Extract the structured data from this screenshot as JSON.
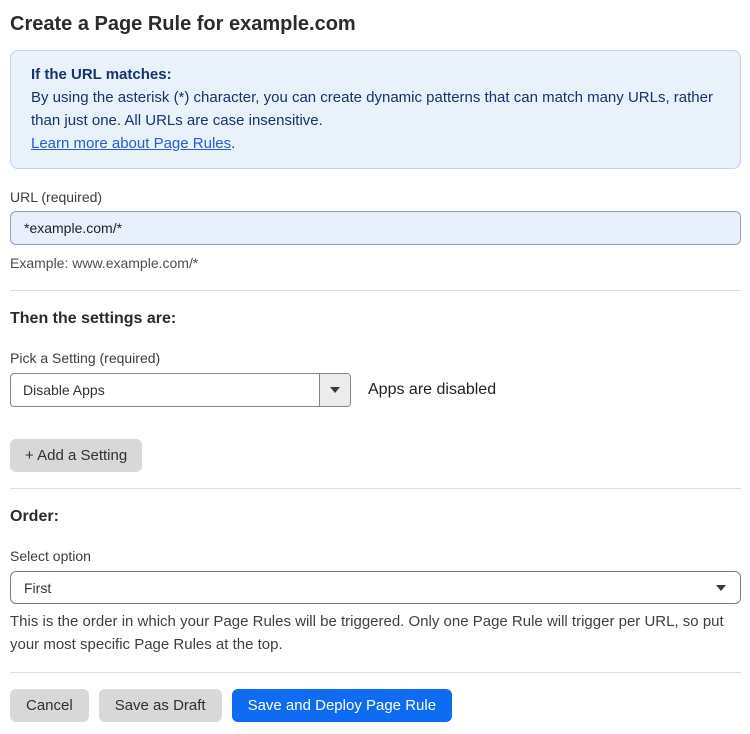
{
  "page": {
    "title": "Create a Page Rule for example.com"
  },
  "info_box": {
    "heading": "If the URL matches:",
    "body": "By using the asterisk (*) character, you can create dynamic patterns that can match many URLs, rather than just one. All URLs are case insensitive.",
    "link_label": "Learn more about Page Rules",
    "link_suffix": "."
  },
  "url_field": {
    "label": "URL (required)",
    "value": "*example.com/*",
    "helper": "Example: www.example.com/*"
  },
  "settings_section": {
    "heading": "Then the settings are:",
    "picker_label": "Pick a Setting (required)",
    "selected_setting": "Disable Apps",
    "status_text": "Apps are disabled",
    "add_button_label": "+ Add a Setting"
  },
  "order_section": {
    "heading": "Order:",
    "select_label": "Select option",
    "selected_option": "First",
    "helper": "This is the order in which your Page Rules will be triggered. Only one Page Rule will trigger per URL, so put your most specific Page Rules at the top."
  },
  "footer": {
    "cancel_label": "Cancel",
    "save_draft_label": "Save as Draft",
    "save_deploy_label": "Save and Deploy Page Rule"
  },
  "colors": {
    "info_bg": "#e9f1fb",
    "info_border": "#bed5f0",
    "info_text": "#16336b",
    "link": "#2c5cc5",
    "input_bg": "#e8f0fd",
    "primary_button": "#0d6cf2",
    "gray_button": "#d8d8d8"
  }
}
